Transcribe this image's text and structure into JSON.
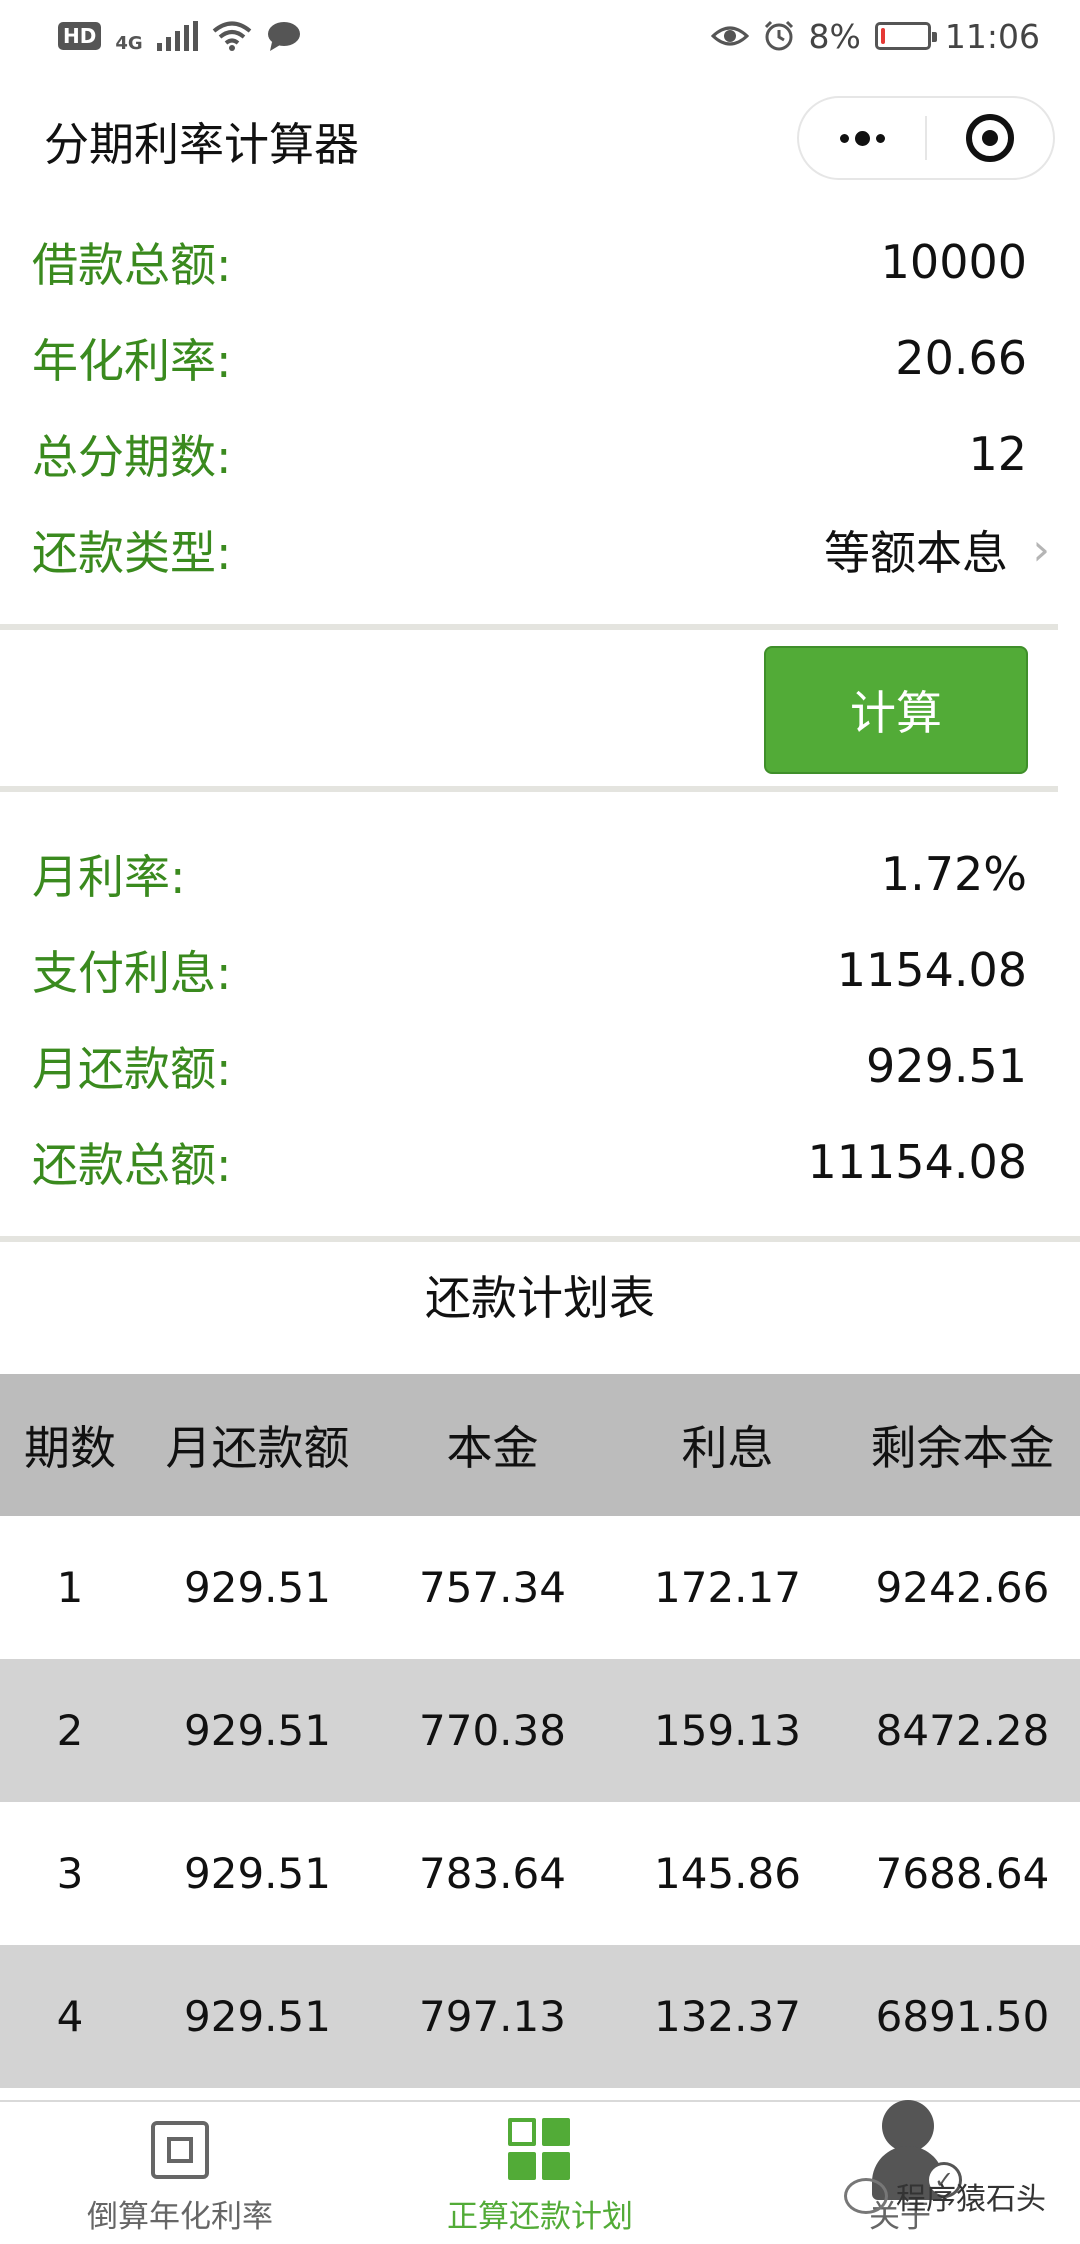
{
  "status_bar": {
    "network_label": "HD",
    "signal_label": "4G",
    "battery_text": "8%",
    "battery_level": 0.08,
    "time": "11:06"
  },
  "nav": {
    "title": "分期利率计算器"
  },
  "inputs": {
    "loan_amount_label": "借款总额:",
    "loan_amount_value": "10000",
    "annual_rate_label": "年化利率:",
    "annual_rate_value": "20.66",
    "periods_label": "总分期数:",
    "periods_value": "12",
    "repay_type_label": "还款类型:",
    "repay_type_value": "等额本息",
    "repay_type_arrow": "›"
  },
  "calc_button_label": "计算",
  "results": {
    "monthly_rate_label": "月利率:",
    "monthly_rate_value": "1.72%",
    "interest_label": "支付利息:",
    "interest_value": "1154.08",
    "monthly_payment_label": "月还款额:",
    "monthly_payment_value": "929.51",
    "total_repay_label": "还款总额:",
    "total_repay_value": "11154.08"
  },
  "schedule": {
    "title": "还款计划表",
    "headers": [
      "期数",
      "月还款额",
      "本金",
      "利息",
      "剩余本金"
    ],
    "rows": [
      [
        "1",
        "929.51",
        "757.34",
        "172.17",
        "9242.66"
      ],
      [
        "2",
        "929.51",
        "770.38",
        "159.13",
        "8472.28"
      ],
      [
        "3",
        "929.51",
        "783.64",
        "145.86",
        "7688.64"
      ],
      [
        "4",
        "929.51",
        "797.13",
        "132.37",
        "6891.50"
      ]
    ]
  },
  "tab_bar": {
    "tabs": [
      {
        "label": "倒算年化利率",
        "icon": "chip-icon",
        "active": false
      },
      {
        "label": "正算还款计划",
        "icon": "grid-icon",
        "active": true
      },
      {
        "label": "关于",
        "icon": "person-icon",
        "active": false
      }
    ]
  },
  "watermark": "程序猿石头",
  "colors": {
    "accent_green": "#52ab37",
    "label_green": "#3a8a1e",
    "header_gray": "#bcbcbc",
    "alt_row_gray": "#d3d3d3"
  }
}
